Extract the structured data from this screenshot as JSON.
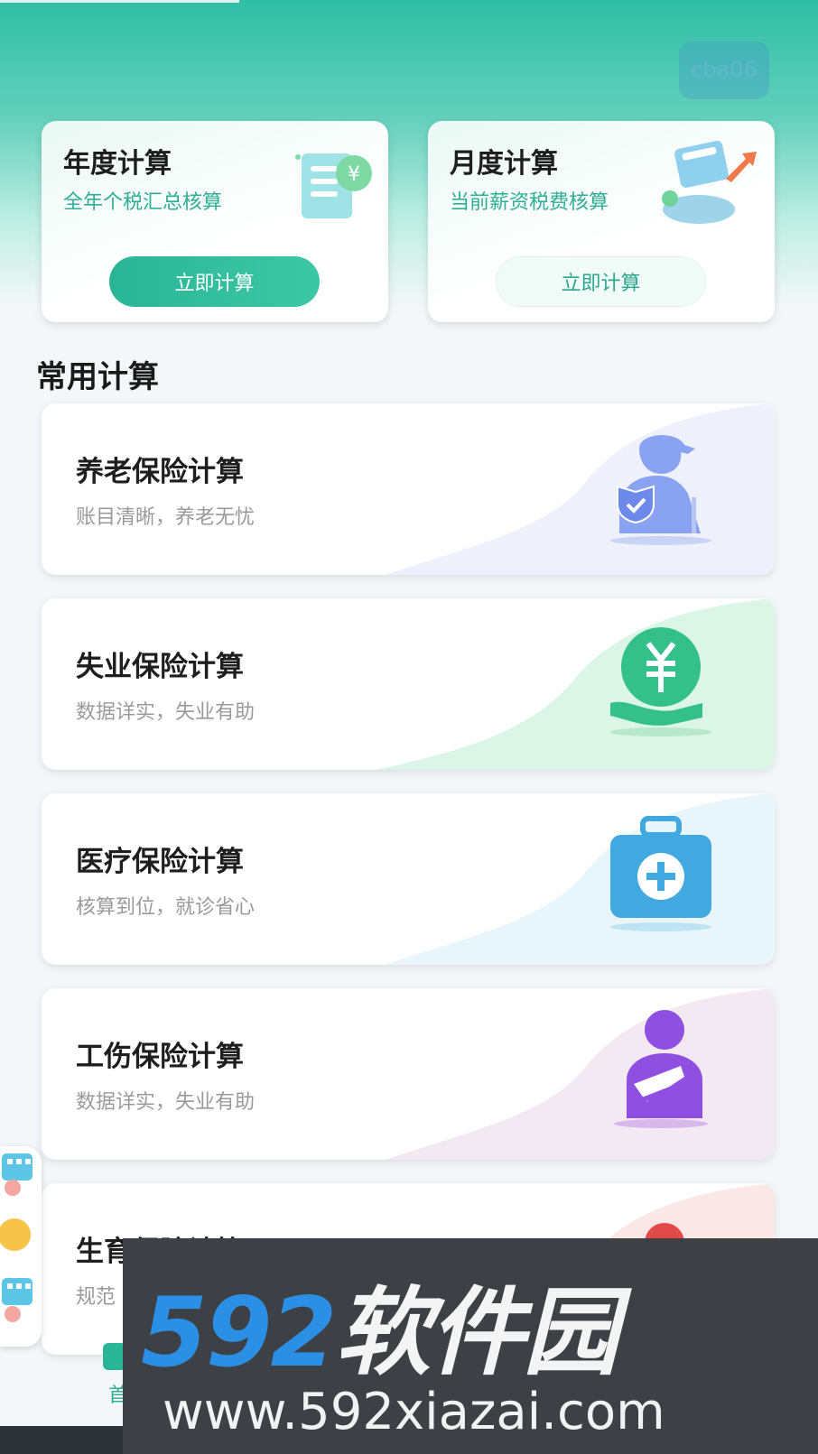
{
  "header": {
    "corner_logo_text": "cba06"
  },
  "top_cards": [
    {
      "title": "年度计算",
      "subtitle": "全年个税汇总核算",
      "button": "立即计算"
    },
    {
      "title": "月度计算",
      "subtitle": "当前薪资税费核算",
      "button": "立即计算"
    }
  ],
  "section": {
    "title": "常用计算"
  },
  "list": [
    {
      "title": "养老保险计算",
      "subtitle": "账目清晰，养老无忧",
      "icon": "elder-shield-icon"
    },
    {
      "title": "失业保险计算",
      "subtitle": "数据详实，失业有助",
      "icon": "yuan-hand-icon"
    },
    {
      "title": "医疗保险计算",
      "subtitle": "核算到位，就诊省心",
      "icon": "medical-kit-icon"
    },
    {
      "title": "工伤保险计算",
      "subtitle": "数据详实，失业有助",
      "icon": "injured-person-icon"
    },
    {
      "title": "生育保险计算",
      "subtitle": "规范",
      "icon": "maternity-icon"
    }
  ],
  "bottom_nav": {
    "first_label": "首"
  },
  "watermark": {
    "brand_num": "592",
    "brand_cn": "软件园",
    "url": "www.592xiazai.com"
  },
  "colors": {
    "primary": "#2ab696",
    "elder": "#7f9bf0",
    "unemploy": "#34c08a",
    "medical": "#42a8e0",
    "injury": "#8f4fe0",
    "maternity": "#e24a4a"
  }
}
